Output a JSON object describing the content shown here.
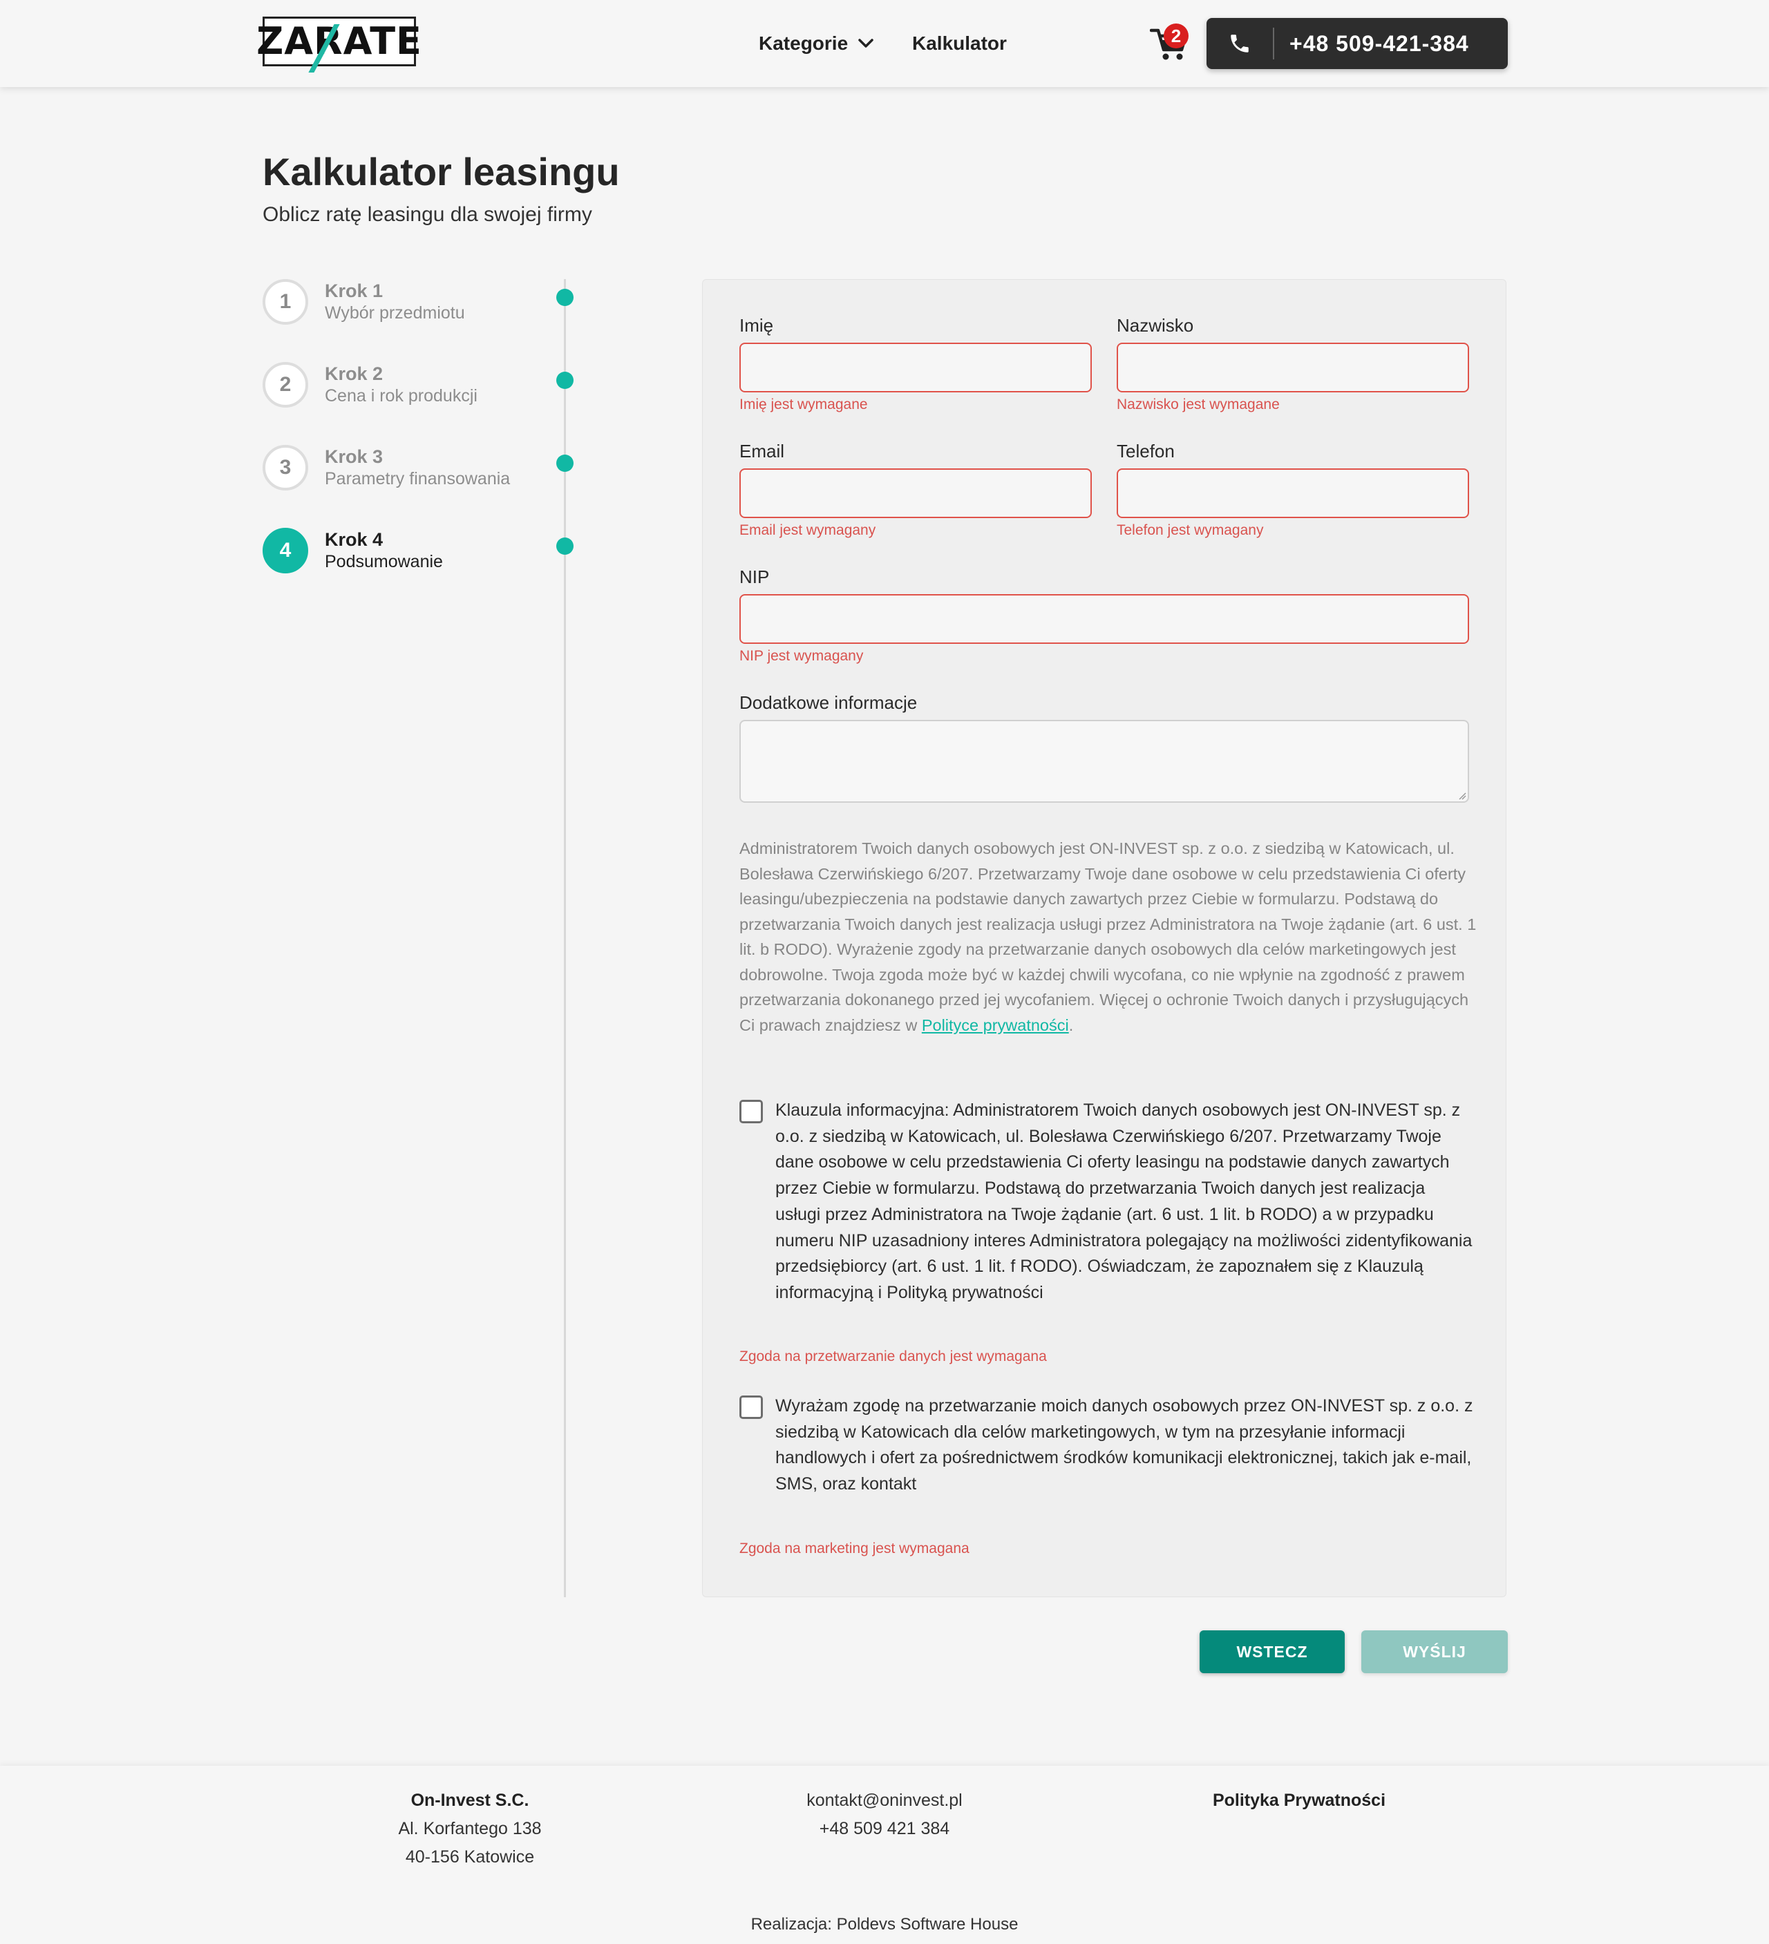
{
  "header": {
    "logo": "ZARATE",
    "nav": [
      {
        "label": "Kategorie"
      },
      {
        "label": "Kalkulator"
      }
    ],
    "cart_count": "2",
    "phone": "+48 509-421-384"
  },
  "page": {
    "title": "Kalkulator leasingu",
    "subtitle": "Oblicz ratę leasingu dla swojej firmy"
  },
  "steps": [
    {
      "num": "1",
      "title": "Krok 1",
      "desc": "Wybór przedmiotu"
    },
    {
      "num": "2",
      "title": "Krok 2",
      "desc": "Cena i rok produkcji"
    },
    {
      "num": "3",
      "title": "Krok 3",
      "desc": "Parametry finansowania"
    },
    {
      "num": "4",
      "title": "Krok 4",
      "desc": "Podsumowanie"
    }
  ],
  "form": {
    "first_name": {
      "label": "Imię",
      "value": "",
      "error": "Imię jest wymagane"
    },
    "last_name": {
      "label": "Nazwisko",
      "value": "",
      "error": "Nazwisko jest wymagane"
    },
    "email": {
      "label": "Email",
      "value": "",
      "error": "Email jest wymagany"
    },
    "phone": {
      "label": "Telefon",
      "value": "",
      "error": "Telefon jest wymagany"
    },
    "nip": {
      "label": "NIP",
      "value": "",
      "error": "NIP jest wymagany"
    },
    "extra": {
      "label": "Dodatkowe informacje",
      "value": ""
    },
    "legal_text": "Administratorem Twoich danych osobowych jest ON-INVEST sp. z o.o. z siedzibą w Katowicach, ul. Bolesława Czerwińskiego 6/207. Przetwarzamy Twoje dane osobowe w celu przedstawienia Ci oferty leasingu/ubezpieczenia na podstawie danych zawartych przez Ciebie w formularzu. Podstawą do przetwarzania Twoich danych jest realizacja usługi przez Administratora na Twoje żądanie (art. 6 ust. 1 lit. b RODO). Wyrażenie zgody na przetwarzanie danych osobowych dla celów marketingowych jest dobrowolne. Twoja zgoda może być w każdej chwili wycofana, co nie wpłynie na zgodność z prawem przetwarzania dokonanego przed jej wycofaniem. Więcej o ochronie Twoich danych i przysługujących Ci prawach znajdziesz w ",
    "legal_link": "Polityce prywatności",
    "legal_end": ".",
    "consent1": {
      "text": "Klauzula informacyjna: Administratorem Twoich danych osobowych jest ON-INVEST sp. z o.o. z siedzibą w Katowicach, ul. Bolesława Czerwińskiego 6/207. Przetwarzamy Twoje dane osobowe w celu przedstawienia Ci oferty leasingu na podstawie danych zawartych przez Ciebie w formularzu. Podstawą do przetwarzania Twoich danych jest realizacja usługi przez Administratora na Twoje żądanie (art. 6 ust. 1 lit. b RODO) a w przypadku numeru NIP uzasadniony interes Administratora polegający na możliwości zidentyfikowania przedsiębiorcy (art. 6 ust. 1 lit. f RODO). Oświadczam, że zapoznałem się z Klauzulą informacyjną i Polityką prywatności",
      "error": "Zgoda na przetwarzanie danych jest wymagana"
    },
    "consent2": {
      "text": "Wyrażam zgodę na przetwarzanie moich danych osobowych przez ON-INVEST sp. z o.o. z siedzibą w Katowicach dla celów marketingowych, w tym na przesyłanie informacji handlowych i ofert za pośrednictwem środków komunikacji elektronicznej, takich jak e-mail, SMS, oraz kontakt",
      "error": "Zgoda na marketing jest wymagana"
    }
  },
  "buttons": {
    "back": "WSTECZ",
    "send": "WYŚLIJ"
  },
  "footer": {
    "company": "On-Invest S.C.",
    "address1": "Al. Korfantego 138",
    "address2": "40-156 Katowice",
    "email": "kontakt@oninvest.pl",
    "phone": "+48 509 421 384",
    "privacy": "Polityka Prywatności",
    "credit": "Realizacja: Poldevs Software House"
  },
  "colors": {
    "accent": "#11b8a4",
    "error": "#d9534f",
    "dark": "#2d2d2d"
  }
}
